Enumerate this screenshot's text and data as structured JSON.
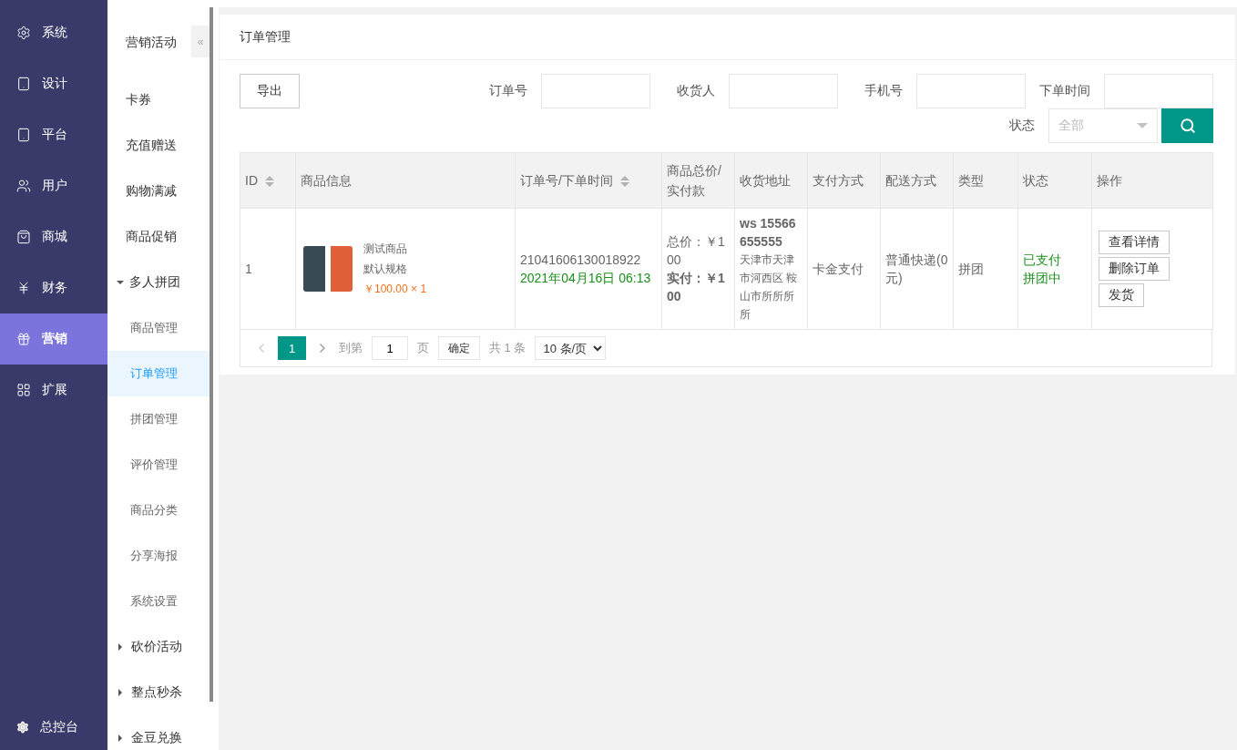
{
  "nav": {
    "items": [
      {
        "label": "系统",
        "selected": false
      },
      {
        "label": "设计",
        "selected": false
      },
      {
        "label": "平台",
        "selected": false
      },
      {
        "label": "用户",
        "selected": false
      },
      {
        "label": "商城",
        "selected": false
      },
      {
        "label": "财务",
        "selected": false
      },
      {
        "label": "营销",
        "selected": true
      },
      {
        "label": "扩展",
        "selected": false
      }
    ],
    "footer": {
      "label": "总控台"
    }
  },
  "submenu": {
    "title": "营销活动",
    "collapse_button": "«",
    "items": [
      {
        "label": "卡券",
        "selected": false
      },
      {
        "label": "充值赠送",
        "selected": false
      },
      {
        "label": "购物满减",
        "selected": false
      },
      {
        "label": "商品促销",
        "selected": false
      },
      {
        "label": "多人拼团",
        "expanded": true,
        "children": [
          {
            "label": "商品管理",
            "selected": false
          },
          {
            "label": "订单管理",
            "selected": true
          },
          {
            "label": "拼团管理",
            "selected": false
          },
          {
            "label": "评价管理",
            "selected": false
          },
          {
            "label": "商品分类",
            "selected": false
          },
          {
            "label": "分享海报",
            "selected": false
          },
          {
            "label": "系统设置",
            "selected": false
          }
        ]
      },
      {
        "label": "砍价活动",
        "expanded": false
      },
      {
        "label": "整点秒杀",
        "expanded": false
      },
      {
        "label": "金豆兑换",
        "expanded": false
      }
    ]
  },
  "card": {
    "title": "订单管理"
  },
  "filters": {
    "export_button": "导出",
    "fields": [
      {
        "label": "订单号"
      },
      {
        "label": "收货人"
      },
      {
        "label": "手机号"
      },
      {
        "label": "下单时间"
      }
    ],
    "status": {
      "label": "状态",
      "placeholder": "全部"
    }
  },
  "table": {
    "columns": [
      {
        "label": "ID",
        "sortable": true
      },
      {
        "label": "商品信息",
        "sortable": false
      },
      {
        "label": "订单号/下单时间",
        "sortable": true
      },
      {
        "label": "商品总价/实付款",
        "sortable": false
      },
      {
        "label": "收货地址",
        "sortable": false
      },
      {
        "label": "支付方式",
        "sortable": false
      },
      {
        "label": "配送方式",
        "sortable": false
      },
      {
        "label": "类型",
        "sortable": false
      },
      {
        "label": "状态",
        "sortable": false
      },
      {
        "label": "操作",
        "sortable": false
      }
    ],
    "rows": [
      {
        "id": "1",
        "product": {
          "name": "测试商品",
          "spec": "默认规格",
          "price": "￥100.00 × 1"
        },
        "order_no": "21041606130018922",
        "order_time": "2021年04月16日 06:13",
        "total": "总价：￥100",
        "paid": "实付：￥100",
        "receiver": "ws 15566655555",
        "address": "天津市天津市河西区 鞍山市所所所所",
        "payment": "卡金支付",
        "delivery": "普通快递(0元)",
        "type": "拼团",
        "status": [
          "已支付",
          "拼团中"
        ],
        "actions": [
          "查看详情",
          "删除订单",
          "发货"
        ]
      }
    ]
  },
  "pagination": {
    "pages": [
      {
        "label": "1",
        "selected": true
      }
    ],
    "goto_label": "到第",
    "goto_value": "1",
    "page_unit": "页",
    "confirm": "确定",
    "total": "共 1 条",
    "page_size": "10 条/页"
  }
}
